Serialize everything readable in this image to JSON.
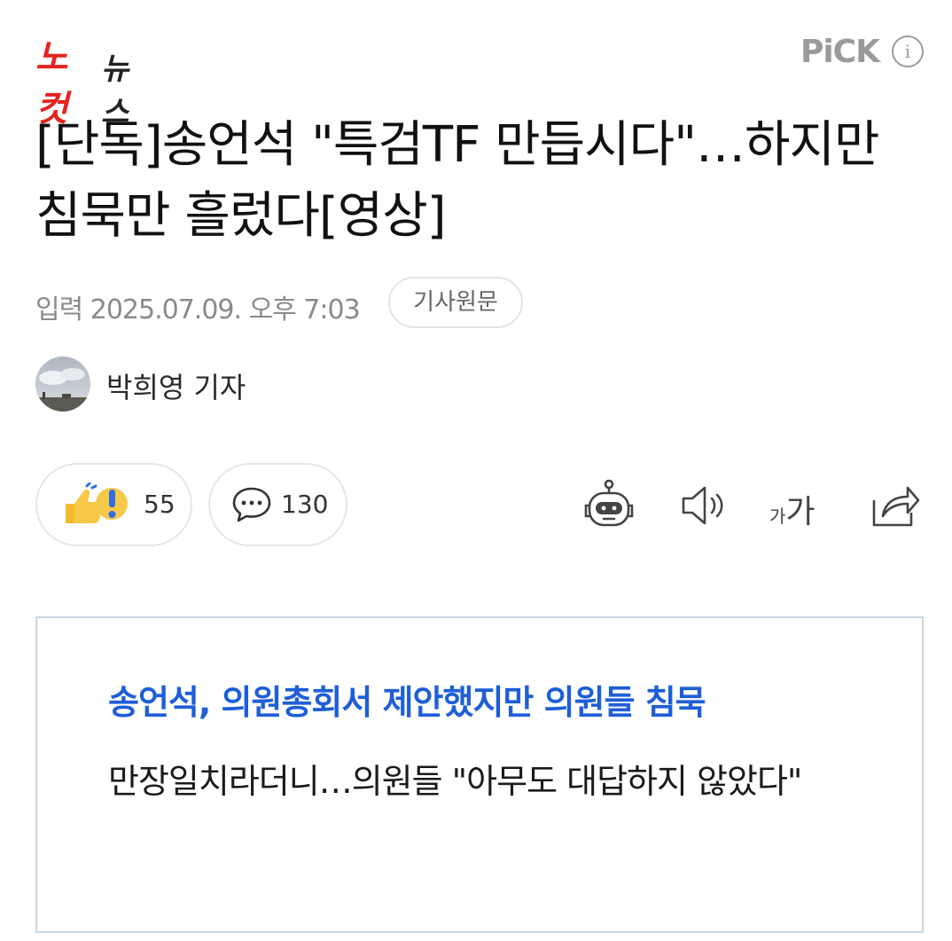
{
  "header": {
    "logo_main": "노컷",
    "logo_sub": "뉴스",
    "pick_label": "PiCK",
    "info_icon": "i"
  },
  "article": {
    "title": "[단독]송언석 \"특검TF 만듭시다\"…하지만 침묵만 흘렀다[영상]",
    "date": "입력 2025.07.09. 오후 7:03",
    "original_button": "기사원문",
    "reporter": "박희영 기자"
  },
  "actions": {
    "reactions_count": "55",
    "comments_count": "130",
    "font_small": "가",
    "font_big": "가",
    "icons": [
      "reaction-icon",
      "comment-icon",
      "summary-bot-icon",
      "speaker-icon",
      "font-size-icon",
      "share-icon"
    ]
  },
  "related": {
    "title": "송언석, 의원총회서 제안했지만 의원들 침묵",
    "subtitle": "만장일치라더니…의원들 \"아무도 대답하지 않았다\""
  },
  "colors": {
    "logo_red": "#e4231f",
    "link_blue": "#1e5ed8",
    "muted_gray": "#8a8a8a",
    "box_border": "#c9d6e8"
  }
}
